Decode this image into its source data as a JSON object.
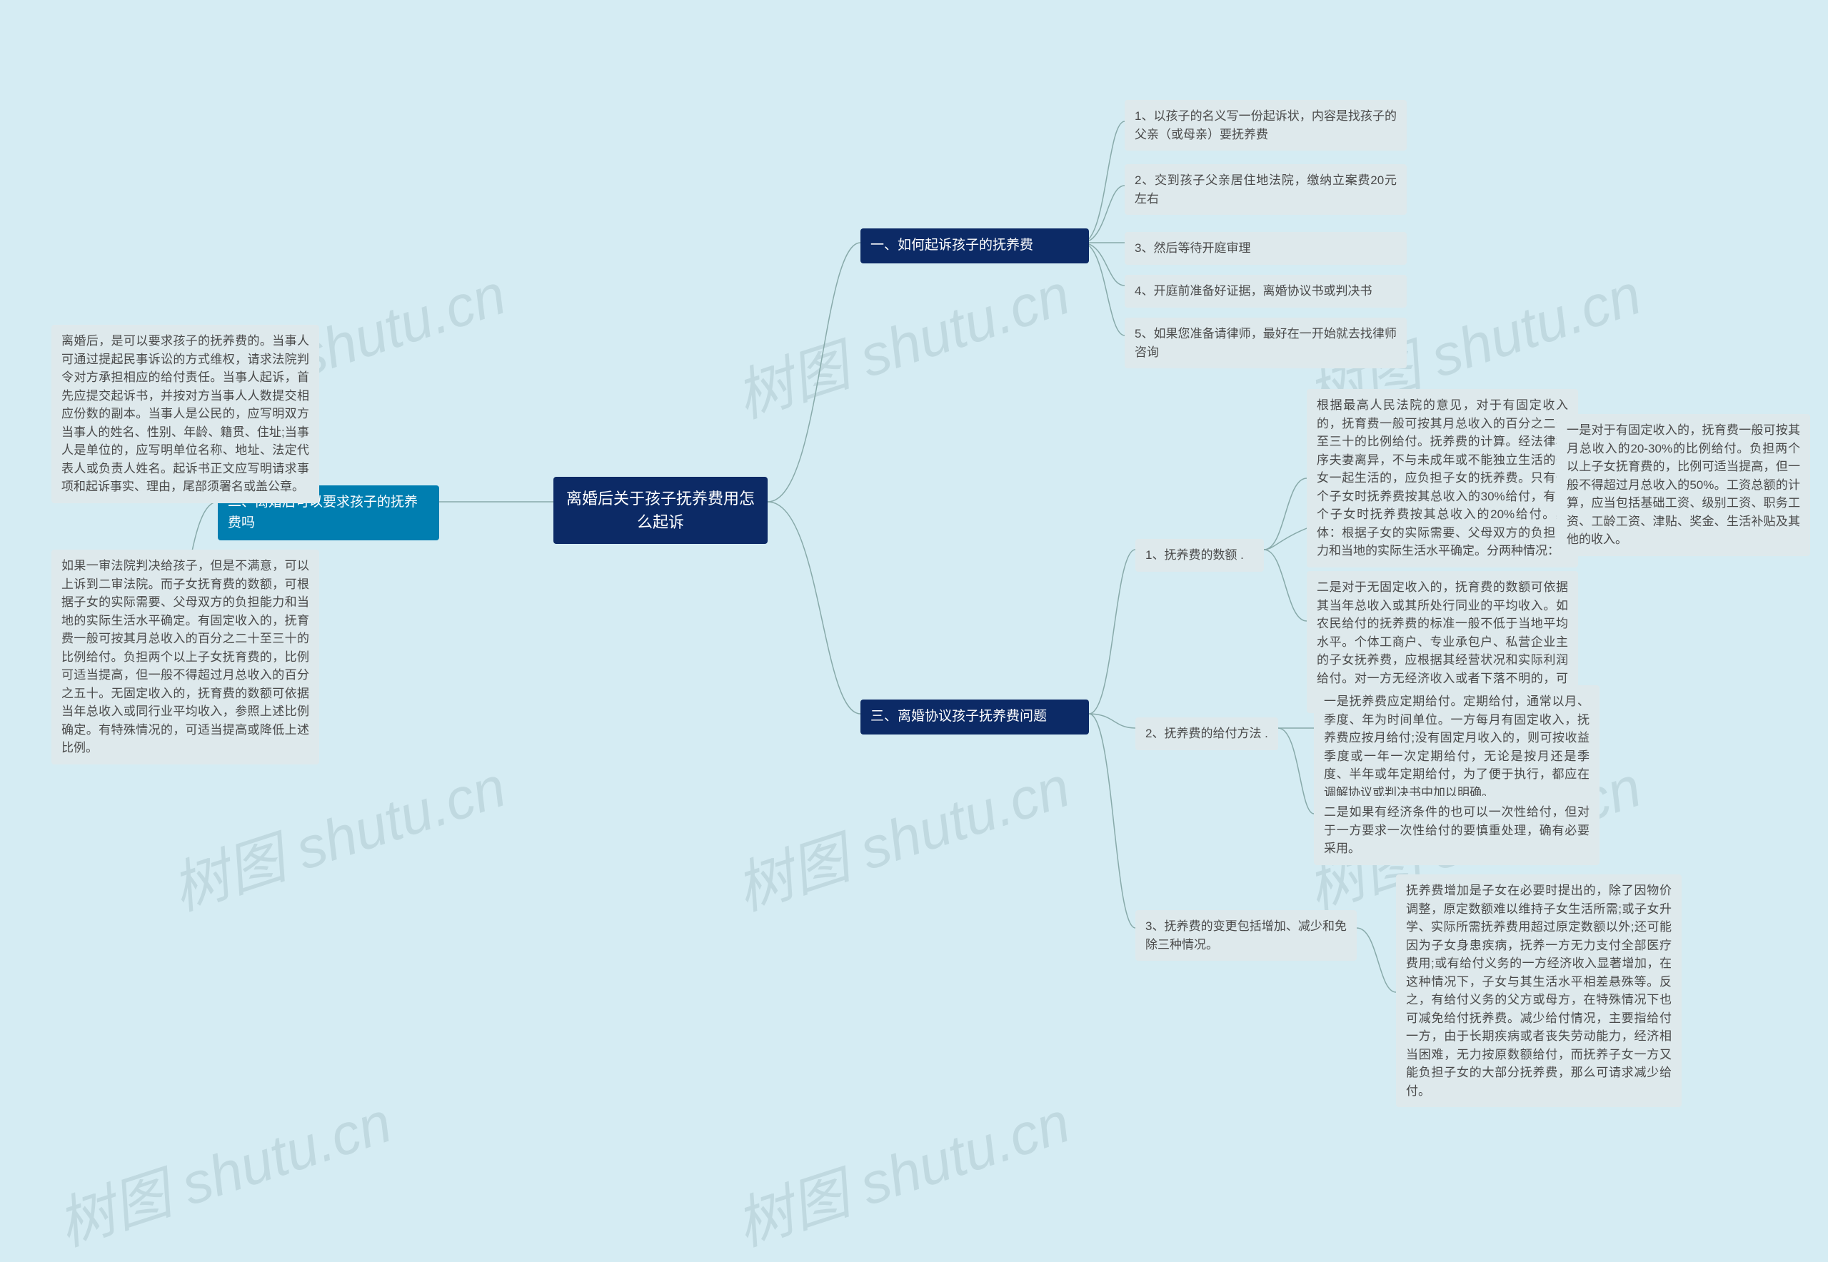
{
  "watermarks": {
    "text": "树图 shutu.cn"
  },
  "root": {
    "title": "离婚后关于孩子抚养费用怎么起诉"
  },
  "branch1": {
    "title": "一、如何起诉孩子的抚养费",
    "items": [
      "1、以孩子的名义写一份起诉状，内容是找孩子的父亲（或母亲）要抚养费",
      "2、交到孩子父亲居住地法院，缴纳立案费20元左右",
      "3、然后等待开庭审理",
      "4、开庭前准备好证据，离婚协议书或判决书",
      "5、如果您准备请律师，最好在一开始就去找律师咨询"
    ]
  },
  "branch2": {
    "title": "二、离婚后可以要求孩子的抚养费吗",
    "leaves": [
      "离婚后，是可以要求孩子的抚养费的。当事人可通过提起民事诉讼的方式维权，请求法院判令对方承担相应的给付责任。当事人起诉，首先应提交起诉书，并按对方当事人人数提交相应份数的副本。当事人是公民的，应写明双方当事人的姓名、性别、年龄、籍贯、住址;当事人是单位的，应写明单位名称、地址、法定代表人或负责人姓名。起诉书正文应写明请求事项和起诉事实、理由，尾部须署名或盖公章。",
      "如果一审法院判决给孩子，但是不满意，可以上诉到二审法院。而子女抚育费的数额，可根据子女的实际需要、父母双方的负担能力和当地的实际生活水平确定。有固定收入的，抚育费一般可按其月总收入的百分之二十至三十的比例给付。负担两个以上子女抚育费的，比例可适当提高，但一般不得超过月总收入的百分之五十。无固定收入的，抚育费的数额可依据当年总收入或同行业平均收入，参照上述比例确定。有特殊情况的，可适当提高或降低上述比例。"
    ]
  },
  "branch3": {
    "title": "三、离婚协议孩子抚养费问题",
    "sub1": {
      "title": "1、抚养费的数额 .",
      "intro": "根据最高人民法院的意见，对于有固定收入的，抚育费一般可按其月总收入的百分之二十至三十的比例给付。抚养费的计算。经法律程序夫妻离异，不与未成年或不能独立生活的子女一起生活的，应负担子女的抚养费。只有一个子女时抚养费按其总收入的30%给付，有多个子女时抚养费按其总收入的20%给付。具体：根据子女的实际需要、父母双方的负担能力和当地的实际生活水平确定。分两种情况：",
      "items": [
        "一是对于有固定收入的，抚育费一般可按其月总收入的20-30%的比例给付。负担两个以上子女抚育费的，比例可适当提高，但一般不得超过月总收入的50%。工资总额的计算，应当包括基础工资、级别工资、职务工资、工龄工资、津贴、奖金、生活补贴及其他的收入。",
        "二是对于无固定收入的，抚育费的数额可依据其当年总收入或其所处行同业的平均收入。如农民给付的抚养费的标准一般不低于当地平均水平。个体工商户、专业承包户、私营企业主的子女抚养费，应根据其经营状况和实际利润给付。对一方无经济收入或者下落不明的，可用其财物折抵子女抚育费。"
      ]
    },
    "sub2": {
      "title": "2、抚养费的给付方法 .",
      "items": [
        "一是抚养费应定期给付。定期给付，通常以月、季度、年为时间单位。一方每月有固定收入，抚养费应按月给付;没有固定月收入的，则可按收益季度或一年一次定期给付，无论是按月还是季度、半年或年定期给付，为了便于执行，都应在调解协议或判决书中加以明确。",
        "二是如果有经济条件的也可以一次性给付，但对于一方要求一次性给付的要慎重处理，确有必要采用。"
      ]
    },
    "sub3": {
      "title": "3、抚养费的变更包括增加、减少和免除三种情况。",
      "detail": "抚养费增加是子女在必要时提出的，除了因物价调整，原定数额难以维持子女生活所需;或子女升学、实际所需抚养费用超过原定数额以外;还可能因为子女身患疾病，抚养一方无力支付全部医疗费用;或有给付义务的一方经济收入显著增加，在这种情况下，子女与其生活水平相差悬殊等。反之，有给付义务的父方或母方，在特殊情况下也可减免给付抚养费。减少给付情况，主要指给付一方，由于长期疾病或者丧失劳动能力，经济相当困难，无力按原数额给付，而抚养子女一方又能负担子女的大部分抚养费，那么可请求减少给付。"
    }
  }
}
